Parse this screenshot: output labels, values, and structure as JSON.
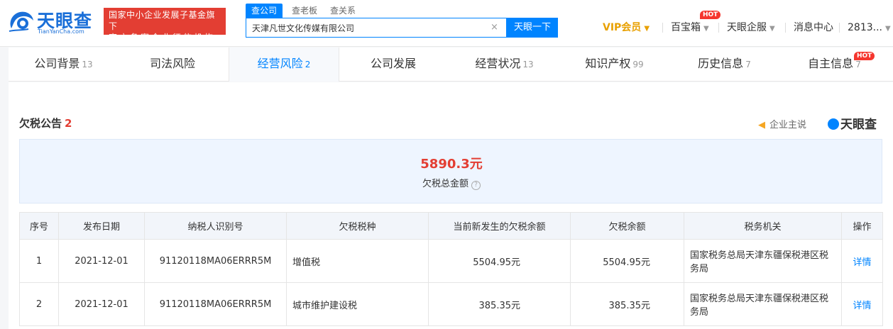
{
  "header": {
    "logo_text": "天眼查",
    "logo_domain": "TianYanCha.com",
    "badge_line1": "国家中小企业发展子基金旗下",
    "badge_line2": "官方备案企业征信机构",
    "search_tabs": [
      "查公司",
      "查老板",
      "查关系"
    ],
    "search_value": "天津凡世文化传媒有限公司",
    "search_clear": "×",
    "search_button": "天眼一下",
    "nav": {
      "vip": "VIP会员",
      "baibaoxiang": "百宝箱",
      "qifu": "天眼企服",
      "messages": "消息中心",
      "user": "2813..."
    },
    "hot_label": "HOT"
  },
  "tabs": [
    {
      "label": "公司背景",
      "count": "13"
    },
    {
      "label": "司法风险",
      "count": ""
    },
    {
      "label": "经营风险",
      "count": "2"
    },
    {
      "label": "公司发展",
      "count": ""
    },
    {
      "label": "经营状况",
      "count": "13"
    },
    {
      "label": "知识产权",
      "count": "99"
    },
    {
      "label": "历史信息",
      "count": "7"
    },
    {
      "label": "自主信息",
      "count": "7"
    }
  ],
  "section": {
    "title": "欠税公告",
    "count": "2",
    "company_says": "企业主说",
    "brand": "天眼查"
  },
  "summary": {
    "amount": "5890.3元",
    "label": "欠税总金额",
    "help": "?"
  },
  "table": {
    "headers": [
      "序号",
      "发布日期",
      "纳税人识别号",
      "欠税税种",
      "当前新发生的欠税余额",
      "欠税余额",
      "税务机关",
      "操作"
    ],
    "rows": [
      [
        "1",
        "2021-12-01",
        "91120118MA06ERRR5M",
        "增值税",
        "5504.95元",
        "5504.95元",
        "国家税务总局天津东疆保税港区税务局",
        "详情"
      ],
      [
        "2",
        "2021-12-01",
        "91120118MA06ERRR5M",
        "城市维护建设税",
        "385.35元",
        "385.35元",
        "国家税务总局天津东疆保税港区税务局",
        "详情"
      ]
    ]
  },
  "colors": {
    "brand_blue": "#0084ff",
    "accent_red": "#e33e33",
    "vip_gold": "#e8a000"
  }
}
